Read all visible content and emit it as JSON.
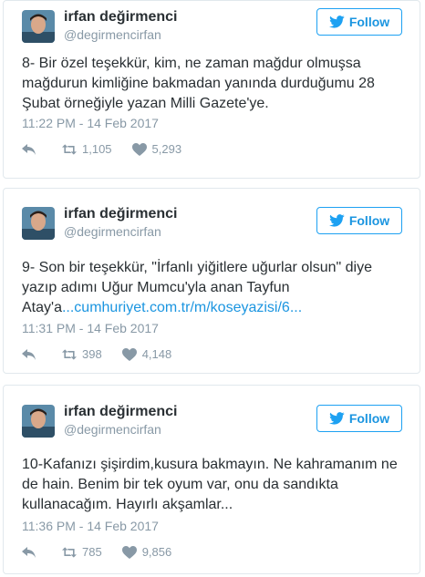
{
  "colors": {
    "accent": "#1da1f2",
    "meta": "#8899a6",
    "text": "#292f33",
    "border": "#e1e8ed"
  },
  "tweets": [
    {
      "name": "irfan değirmenci",
      "handle": "@degirmencirfan",
      "follow_label": "Follow",
      "text": "8- Bir özel teşekkür, kim, ne zaman mağdur olmuşsa mağdurun kimliğine bakmadan yanında durduğumu 28 Şubat örneğiyle yazan Milli Gazete'ye.",
      "link": "",
      "time": "11:22 PM - 14 Feb 2017",
      "retweets": "1,105",
      "likes": "5,293"
    },
    {
      "name": "irfan değirmenci",
      "handle": "@degirmencirfan",
      "follow_label": "Follow",
      "text": "9- Son bir teşekkür, \"İrfanlı yiğitlere uğurlar olsun\" diye yazıp adımı Uğur Mumcu'yla anan Tayfun Atay'a",
      "link": "...cumhuriyet.com.tr/m/koseyazisi/6...",
      "time": "11:31 PM - 14 Feb 2017",
      "retweets": "398",
      "likes": "4,148"
    },
    {
      "name": "irfan değirmenci",
      "handle": "@degirmencirfan",
      "follow_label": "Follow",
      "text": "10-Kafanızı şişirdim,kusura bakmayın. Ne kahramanım ne de hain. Benim bir tek oyum var, onu da sandıkta kullanacağım. Hayırlı akşamlar...",
      "link": "",
      "time": "11:36 PM - 14 Feb 2017",
      "retweets": "785",
      "likes": "9,856"
    }
  ]
}
